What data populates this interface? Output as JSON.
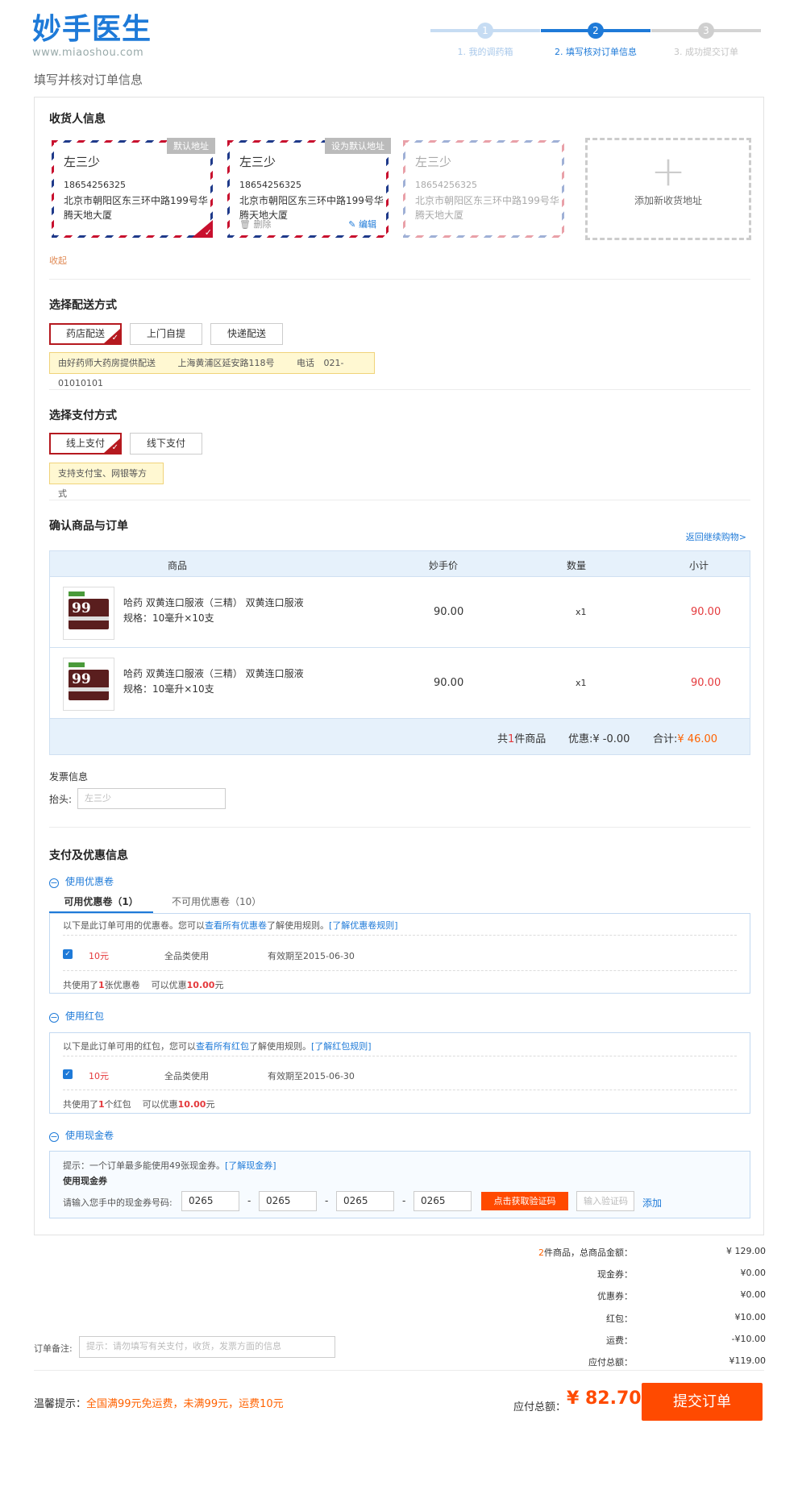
{
  "header": {
    "logo_text": "妙手医生",
    "logo_url": "www.miaoshou.com",
    "steps": [
      {
        "num": "1",
        "label": "1. 我的调药箱",
        "state": "done"
      },
      {
        "num": "2",
        "label": "2. 填写核对订单信息",
        "state": "active"
      },
      {
        "num": "3",
        "label": "3. 成功提交订单",
        "state": "todo"
      }
    ],
    "subtitle": "填写并核对订单信息"
  },
  "consignee": {
    "title": "收货人信息",
    "cards": [
      {
        "name": "左三少",
        "phone": "18654256325",
        "address": "北京市朝阳区东三环中路199号华腾天地大厦",
        "tag": "默认地址",
        "selected": true
      },
      {
        "name": "左三少",
        "phone": "18654256325",
        "address": "北京市朝阳区东三环中路199号华腾天地大厦",
        "tag": "设为默认地址",
        "delete": "删除",
        "edit": "编辑",
        "selected": false
      },
      {
        "name": "左三少",
        "phone": "18654256325",
        "address": "北京市朝阳区东三环中路199号华腾天地大厦",
        "selected": false
      }
    ],
    "add_label": "添加新收货地址",
    "collapse_label": "收起"
  },
  "delivery": {
    "title": "选择配送方式",
    "options": [
      "药店配送",
      "上门自提",
      "快递配送"
    ],
    "selected": 0,
    "tip": {
      "text": "由好药师大药房提供配送",
      "address": "上海黄浦区延安路118号",
      "phone_label": "电话",
      "phone": "021-01010101"
    }
  },
  "payment": {
    "title": "选择支付方式",
    "options": [
      "线上支付",
      "线下支付"
    ],
    "selected": 0,
    "tip": "支持支付宝、网银等方式"
  },
  "order": {
    "title": "确认商品与订单",
    "back_link": "返回继续购物>",
    "columns": [
      "商品",
      "妙手价",
      "数量",
      "小计"
    ],
    "items": [
      {
        "name": "哈药 双黄连口服液（三精） 双黄连口服液",
        "spec": "规格：10毫升×10支",
        "price": "90.00",
        "qty": "x1",
        "subtotal": "90.00"
      },
      {
        "name": "哈药 双黄连口服液（三精） 双黄连口服液",
        "spec": "规格：10毫升×10支",
        "price": "90.00",
        "qty": "x1",
        "subtotal": "90.00"
      }
    ],
    "footer": {
      "count_prefix": "共",
      "count": "1",
      "count_suffix": "件商品",
      "discount_label": "优惠:",
      "discount": "¥ -0.00",
      "total_label": "合计:",
      "total": "¥ 46.00"
    }
  },
  "invoice": {
    "title": "发票信息",
    "header_label": "抬头:",
    "header_value": "左三少"
  },
  "benefits": {
    "title": "支付及优惠信息",
    "coupon": {
      "toggle": "使用优惠卷",
      "tab_available": "可用优惠卷（1）",
      "tab_unavailable": "不可用优惠卷（10）",
      "note_prefix": "以下是此订单可用的优惠卷。您可以",
      "note_link": "查看所有优惠卷",
      "note_mid": "了解使用规则。",
      "note_rule": "[了解优惠卷规则]",
      "item": {
        "amount": "10元",
        "scope": "全品类使用",
        "expiry": "有效期至2015-06-30"
      },
      "summary_prefix": "共使用了",
      "summary_count": "1",
      "summary_unit": "张优惠卷",
      "summary_save": "可以优惠",
      "summary_amount": "10.00",
      "summary_currency": "元"
    },
    "redpack": {
      "toggle": "使用红包",
      "note_prefix": "以下是此订单可用的红包，您可以",
      "note_link": "查看所有红包",
      "note_mid": "了解使用规则。",
      "note_rule": "[了解红包规则]",
      "item": {
        "amount": "10元",
        "scope": "全品类使用",
        "expiry": "有效期至2015-06-30"
      },
      "summary_prefix": "共使用了",
      "summary_count": "1",
      "summary_unit": "个红包",
      "summary_save": "可以优惠",
      "summary_amount": "10.00",
      "summary_currency": "元"
    },
    "cash": {
      "toggle": "使用现金卷",
      "note": "提示：一个订单最多能使用49张现金券。",
      "note_link": "[了解现金券]",
      "subtitle": "使用现金券",
      "input_label": "请输入您手中的现金券号码:",
      "codes": [
        "0265",
        "0265",
        "0265",
        "0265"
      ],
      "sep": "-",
      "get_code_button": "点击获取验证码",
      "verify_placeholder": "输入验证码",
      "add_link": "添加"
    }
  },
  "summary": {
    "rows": [
      {
        "key_prefix": "2",
        "key": "件商品，总商品金额：",
        "value": "¥ 129.00"
      },
      {
        "key": "现金券：",
        "value": "¥0.00"
      },
      {
        "key": "优惠券：",
        "value": "¥0.00"
      },
      {
        "key": "红包：",
        "value": "¥10.00"
      },
      {
        "key": "运费：",
        "value": "-¥10.00"
      },
      {
        "key": "应付总额：",
        "value": "¥119.00"
      }
    ],
    "remark_label": "订单备注:",
    "remark_placeholder": "提示：请勿填写有关支付，收货，发票方面的信息"
  },
  "footer": {
    "tip_label": "温馨提示：",
    "tip_text": "全国满99元免运费，未满99元，运费10元",
    "payable_label": "应付总额：",
    "payable_amount": "¥ 82.70",
    "submit_label": "提交订单"
  },
  "colors": {
    "brand_blue": "#1e7ad8",
    "accent_red": "#b5191f",
    "price_red": "#e4393c",
    "submit_orange": "#ff4a00"
  }
}
